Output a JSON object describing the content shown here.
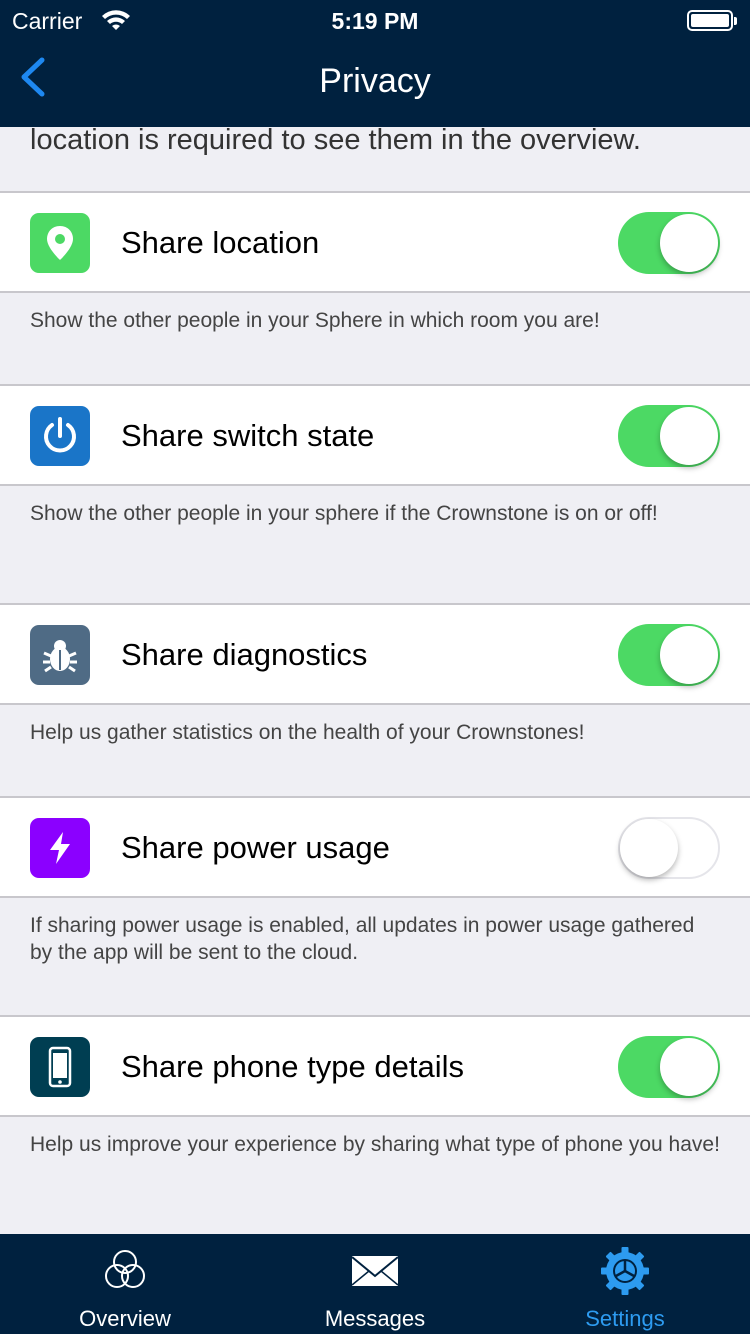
{
  "status_bar": {
    "carrier": "Carrier",
    "time": "5:19 PM"
  },
  "nav": {
    "title": "Privacy"
  },
  "intro": "location is required to see them in the overview.",
  "settings": [
    {
      "label": "Share location",
      "enabled": true,
      "icon": "location-pin-icon",
      "icon_color": "#4cd964",
      "description": "Show the other people in your Sphere in which room you are!"
    },
    {
      "label": "Share switch state",
      "enabled": true,
      "icon": "power-icon",
      "icon_color": "#1a75c8",
      "description": "Show the other people in your sphere if the Crownstone is on or off!"
    },
    {
      "label": "Share diagnostics",
      "enabled": true,
      "icon": "bug-icon",
      "icon_color": "#4f6b85",
      "description": "Help us gather statistics on the health of your Crownstones!"
    },
    {
      "label": "Share power usage",
      "enabled": false,
      "icon": "lightning-icon",
      "icon_color": "#8b00ff",
      "description": "If sharing power usage is enabled, all updates in power usage gathered by the app will be sent to the cloud."
    },
    {
      "label": "Share phone type details",
      "enabled": true,
      "icon": "phone-icon",
      "icon_color": "#003e52",
      "description": "Help us improve your experience by sharing what type of phone you have!"
    }
  ],
  "tabs": [
    {
      "label": "Overview",
      "icon": "overview-circles-icon",
      "active": false
    },
    {
      "label": "Messages",
      "icon": "envelope-icon",
      "active": false
    },
    {
      "label": "Settings",
      "icon": "gear-icon",
      "active": true
    }
  ],
  "colors": {
    "header": "#00213f",
    "toggle_on": "#4cd964",
    "active_tab": "#2d9bf0",
    "back": "#1e88f0"
  }
}
